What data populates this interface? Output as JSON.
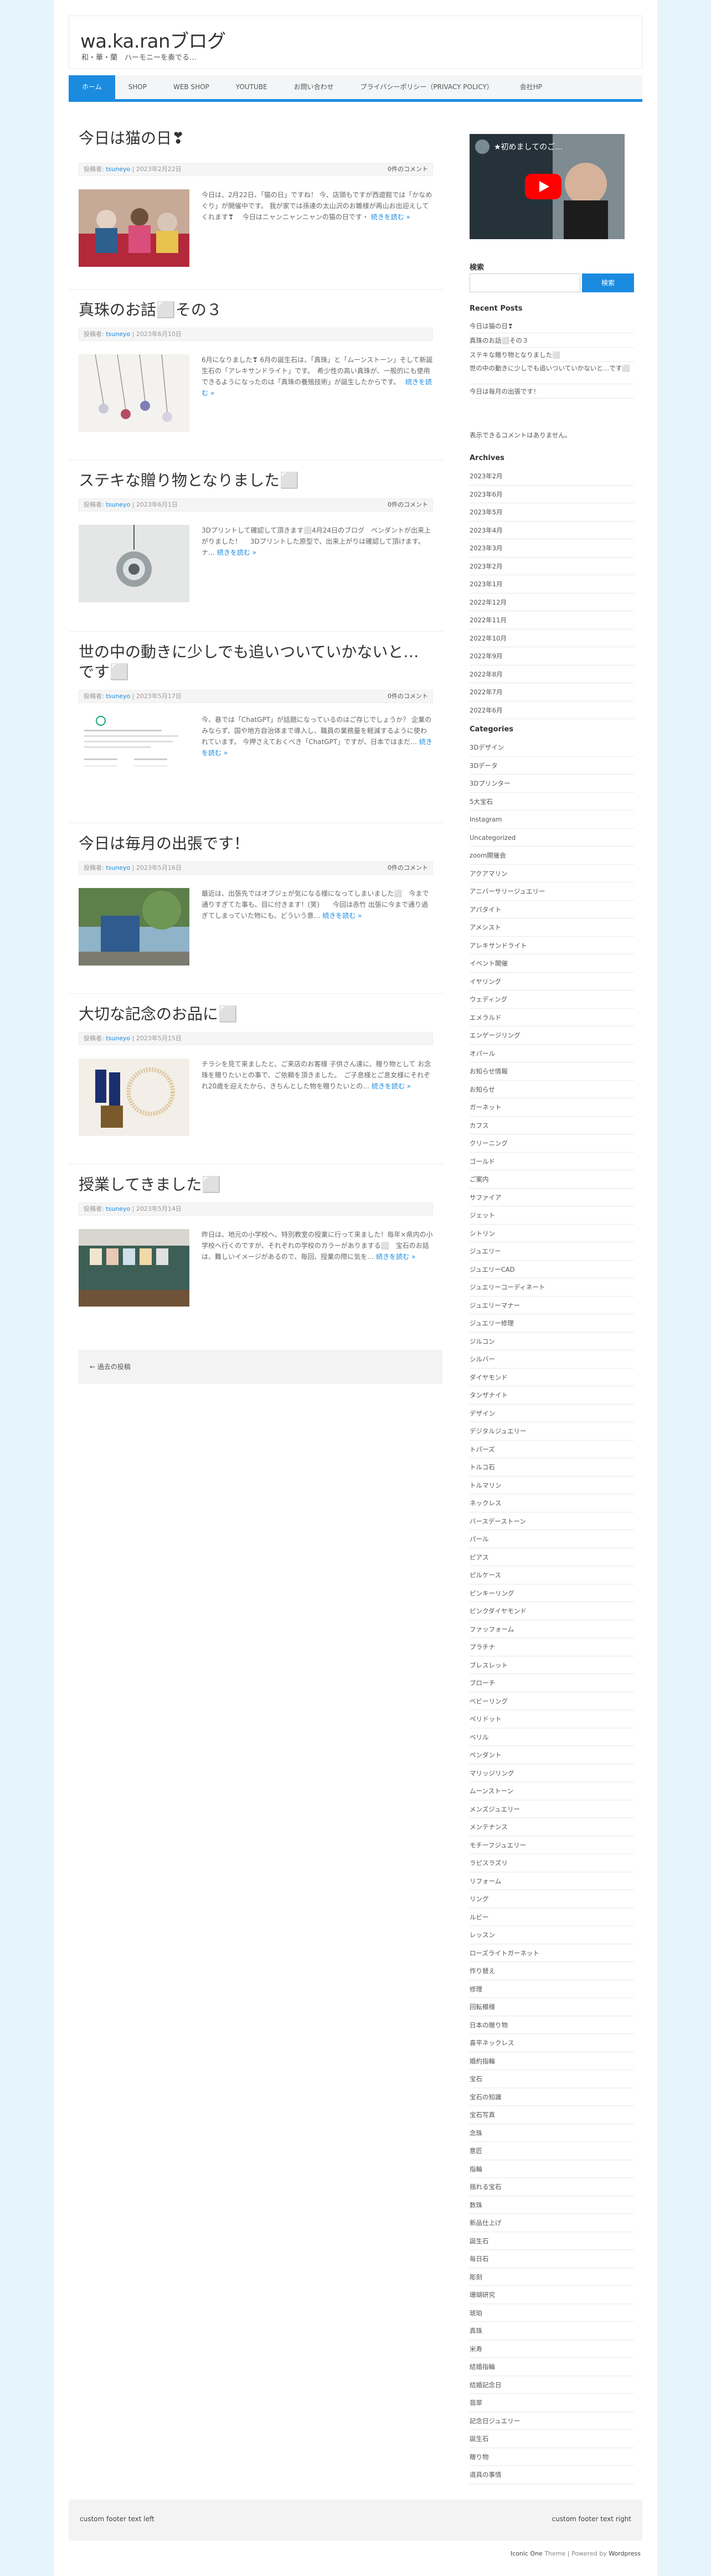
{
  "site": {
    "title": "wa.ka.ranブログ",
    "description": "和・華・蘭　ハーモニーを奏でる…"
  },
  "nav": [
    "ホーム",
    "SHOP",
    "WEB SHOP",
    "YOUTUBE",
    "お問い合わせ",
    "プライバシーポリシー（PRIVACY POLICY）",
    "会社HP"
  ],
  "meta_labels": {
    "prefix": "投稿者:",
    "comments": "0件のコメント"
  },
  "more_label": "続きを読む »",
  "posts": [
    {
      "title": "今日は猫の日❣",
      "author": "tsuneyo",
      "date": "2023年2月22日",
      "excerpt": "今日は、2月22日、「猫の日」ですね！ 今、店頭もですが西遊館では「かなめぐり」が開催中です。 我が家では孫達の太山沢のお雛様が再山お出迎えしてくれます❣　 今日はニャンニャンニャンの猫の日です・"
    },
    {
      "title": "真珠のお話⬜その３",
      "author": "tsuneyo",
      "date": "2023年6月10日",
      "excerpt": "6月になりました❣ 6月の誕生石は、「真珠」と「ムーンストーン」そして新誕生石の「アレキサンドライト」です。　希少性の高い真珠が、一般的にも使用できるようになったのは「真珠の養殖技術」が誕生したからです。　"
    },
    {
      "title": "ステキな贈り物となりました⬜",
      "author": "tsuneyo",
      "date": "2023年6月1日",
      "excerpt": "3Dプリントして確認して頂きます⬜4月24日のブログ　ペンダントが出来上がりました！ 　3Dプリントした原型で、出来上がりは確認して頂けます。　 ナ…"
    },
    {
      "title": "世の中の動きに少しでも追いついていかないと…です⬜",
      "author": "tsuneyo",
      "date": "2023年5月17日",
      "excerpt": "今、巷では「ChatGPT」が話題になっているのはご存じでしょうか？ 企業のみならず、国や地方自治体まで導入し、職員の業務量を軽減するように使われています。 今押さえておくべき「ChatGPT」ですが、日本ではまだ…"
    },
    {
      "title": "今日は毎月の出張です！",
      "author": "tsuneyo",
      "date": "2023年5月16日",
      "excerpt": "最近は、出張先ではオブジェが気になる様になってしまいました⬜　今まで通りすぎてた事も、目に付きます！(笑)　　今回は赤竹 出張に今まで通り過ぎてしまっていた物にも、どういう意…"
    },
    {
      "title": "大切な記念のお品に⬜",
      "author": "tsuneyo",
      "date": "2023年5月15日",
      "excerpt": "チラシを見て来ましたと、ご来店のお客様 子供さん達に、贈り物として お念珠を贈りたいとの事で、ご依頼を頂きました。　ご子息様とご息女様にそれぞれ20歳を迎えたから、きちんとした物を贈りたいとの…"
    },
    {
      "title": "授業してきました⬜",
      "author": "tsuneyo",
      "date": "2023年5月14日",
      "excerpt": "昨日は、地元の小学校へ、特別教室の授業に行って来ました！毎年×県内の小学校へ行くのですが、それぞれの学校のカラーがありまする⬜　宝石のお話は、難しいイメージがあるので、毎回、授業の際に気を…"
    }
  ],
  "older_posts": "← 過去の投稿",
  "sidebar": {
    "video_title": "★初めましてのご…",
    "search_title": "検索",
    "search_button": "検索",
    "recent_posts_title": "Recent Posts",
    "recent_posts": [
      "今日は猫の日❣",
      "真珠のお話⬜その３",
      "ステキな贈り物となりました⬜",
      "世の中の動きに少しでも追いついていかないと…です⬜",
      "今日は毎月の出張です！"
    ],
    "recent_comments_title": "表示できるコメントはありません。",
    "archives_title": "Archives",
    "archives": [
      "2023年2月",
      "2023年6月",
      "2023年5月",
      "2023年4月",
      "2023年3月",
      "2023年2月",
      "2023年1月",
      "2022年12月",
      "2022年11月",
      "2022年10月",
      "2022年9月",
      "2022年8月",
      "2022年7月",
      "2022年6月"
    ],
    "categories_title": "Categories",
    "categories": [
      "3Dデザイン",
      "3Dデータ",
      "3Dプリンター",
      "5大宝石",
      "Instagram",
      "Uncategorized",
      "zoom開催会",
      "アクアマリン",
      "アニバーサリージュエリー",
      "アパタイト",
      "アメシスト",
      "アレキサンドライト",
      "イベント開催",
      "イヤリング",
      "ウェディング",
      "エメラルド",
      "エンゲージリング",
      "オパール",
      "お知らせ情報",
      "お知らせ",
      "ガーネット",
      "カフス",
      "クリーニング",
      "ゴールド",
      "ご案内",
      "サファイア",
      "ジェット",
      "シトリン",
      "ジュエリー",
      "ジュエリーCAD",
      "ジュエリーコーディネート",
      "ジュエリーマナー",
      "ジュエリー修理",
      "ジルコン",
      "シルバー",
      "ダイヤモンド",
      "タンザナイト",
      "デザイン",
      "デジタルジュエリー",
      "トパーズ",
      "トルコ石",
      "トルマリン",
      "ネックレス",
      "バースデーストーン",
      "パール",
      "ピアス",
      "ピルケース",
      "ピンキーリング",
      "ピンクダイヤモンド",
      "ファッフォーム",
      "プラチナ",
      "ブレスレット",
      "ブローチ",
      "ベビーリング",
      "ペリドット",
      "ベリル",
      "ペンダント",
      "マリッジリング",
      "ムーンストーン",
      "メンズジュエリー",
      "メンテナンス",
      "モチーフジュエリー",
      "ラピスラズリ",
      "リフォーム",
      "リング",
      "ルビー",
      "レッスン",
      "ローズライトガーネット",
      "作り替え",
      "修理",
      "回転模様",
      "日本の贈り物",
      "喜平ネックレス",
      "婚約指輪",
      "宝石",
      "宝石の知識",
      "宝石写真",
      "念珠",
      "意匠",
      "指輪",
      "揺れる宝石",
      "数珠",
      "新品仕上げ",
      "誕生石",
      "毎日石",
      "彫刻",
      "珊瑚研究",
      "琥珀",
      "真珠",
      "米寿",
      "結婚指輪",
      "結婚記念日",
      "翡翠",
      "記念日ジュエリー",
      "誕生石",
      "贈り物",
      "道具の事情"
    ]
  },
  "footer": {
    "left": "custom footer text left",
    "right": "custom footer text right",
    "credit_theme": "Iconic One",
    "credit_mid": " Theme | Powered by ",
    "credit_wp": "Wordpress"
  },
  "colors": {
    "accent": "#1b8be0",
    "background": "#e6f5fc"
  }
}
